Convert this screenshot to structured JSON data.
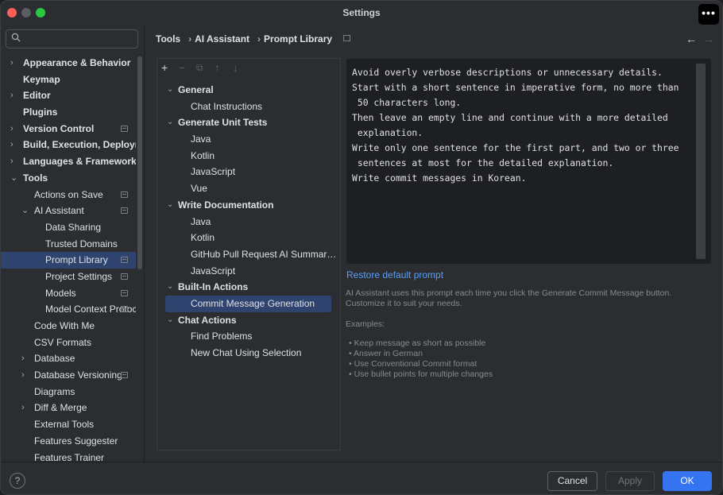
{
  "window": {
    "title": "Settings",
    "more_label": "•••"
  },
  "search": {
    "icon": "search-icon",
    "value": ""
  },
  "sidebar": {
    "items": [
      {
        "label": "Appearance & Behavior",
        "chevron": "›",
        "bold": true
      },
      {
        "label": "Keymap",
        "chevron": "",
        "bold": true
      },
      {
        "label": "Editor",
        "chevron": "›",
        "bold": true
      },
      {
        "label": "Plugins",
        "chevron": "",
        "bold": true
      },
      {
        "label": "Version Control",
        "chevron": "›",
        "bold": true,
        "badge": true
      },
      {
        "label": "Build, Execution, Deployment",
        "chevron": "›",
        "bold": true
      },
      {
        "label": "Languages & Frameworks",
        "chevron": "›",
        "bold": true
      },
      {
        "label": "Tools",
        "chevron": "⌄",
        "bold": true
      },
      {
        "label": "Actions on Save",
        "indent": 1,
        "badge": true
      },
      {
        "label": "AI Assistant",
        "indent": 1,
        "chevron": "⌄",
        "badge": true
      },
      {
        "label": "Data Sharing",
        "indent": 2
      },
      {
        "label": "Trusted Domains",
        "indent": 2
      },
      {
        "label": "Prompt Library",
        "indent": 2,
        "badge": true,
        "selected": true
      },
      {
        "label": "Project Settings",
        "indent": 2,
        "badge": true
      },
      {
        "label": "Models",
        "indent": 2,
        "badge": true
      },
      {
        "label": "Model Context Protocol",
        "indent": 2,
        "badge": true
      },
      {
        "label": "Code With Me",
        "indent": 1
      },
      {
        "label": "CSV Formats",
        "indent": 1
      },
      {
        "label": "Database",
        "indent": 1,
        "chevron": "›"
      },
      {
        "label": "Database Versioning",
        "indent": 1,
        "chevron": "›",
        "badge": true
      },
      {
        "label": "Diagrams",
        "indent": 1
      },
      {
        "label": "Diff & Merge",
        "indent": 1,
        "chevron": "›"
      },
      {
        "label": "External Tools",
        "indent": 1
      },
      {
        "label": "Features Suggester",
        "indent": 1
      },
      {
        "label": "Features Trainer",
        "indent": 1
      }
    ]
  },
  "breadcrumb": {
    "items": [
      "Tools",
      "AI Assistant",
      "Prompt Library"
    ],
    "sep": "›"
  },
  "nav": {
    "back": "←",
    "forward": "→"
  },
  "toolbar": {
    "add": "+",
    "remove": "−",
    "copy": "⧉",
    "up": "↑",
    "down": "↓"
  },
  "prompt_tree": [
    {
      "label": "General",
      "group": true
    },
    {
      "label": "Chat Instructions"
    },
    {
      "label": "Generate Unit Tests",
      "group": true
    },
    {
      "label": "Java"
    },
    {
      "label": "Kotlin"
    },
    {
      "label": "JavaScript"
    },
    {
      "label": "Vue"
    },
    {
      "label": "Write Documentation",
      "group": true
    },
    {
      "label": "Java"
    },
    {
      "label": "Kotlin"
    },
    {
      "label": "GitHub Pull Request AI Summarization"
    },
    {
      "label": "JavaScript"
    },
    {
      "label": "Built-In Actions",
      "group": true
    },
    {
      "label": "Commit Message Generation",
      "selected": true
    },
    {
      "label": "Chat Actions",
      "group": true
    },
    {
      "label": "Find Problems"
    },
    {
      "label": "New Chat Using Selection"
    }
  ],
  "editor": {
    "text": "Avoid overly verbose descriptions or unnecessary details.\nStart with a short sentence in imperative form, no more than\n 50 characters long.\nThen leave an empty line and continue with a more detailed\n explanation.\nWrite only one sentence for the first part, and two or three\n sentences at most for the detailed explanation.\nWrite commit messages in Korean."
  },
  "restore_label": "Restore default prompt",
  "help_text": "AI Assistant uses this prompt each time you click the Generate Commit Message button.\nCustomize it to suit your needs.",
  "examples_label": "Examples:",
  "examples": [
    "• Keep message as short as possible",
    "• Answer in German",
    "• Use Conventional Commit format",
    "• Use bullet points for multiple changes"
  ],
  "footer": {
    "help": "?",
    "cancel": "Cancel",
    "apply": "Apply",
    "ok": "OK"
  }
}
